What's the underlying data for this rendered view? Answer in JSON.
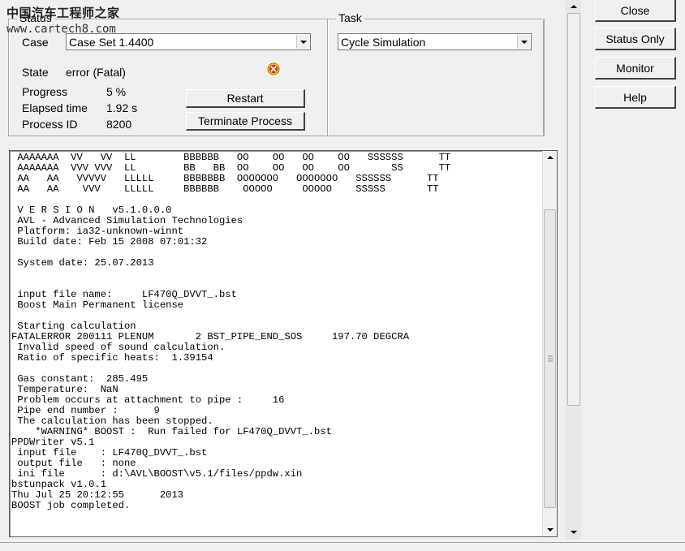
{
  "watermark": {
    "line1": "中国汽车工程师之家",
    "line2": "www.cartech8.com"
  },
  "status": {
    "group_title": "Status",
    "case_label": "Case",
    "case_value": "Case Set 1.4400",
    "state_label": "State",
    "state_value": "error (Fatal)",
    "progress_label": "Progress",
    "progress_value": "5 %",
    "elapsed_label": "Elapsed time",
    "elapsed_value": "1.92 s",
    "pid_label": "Process ID",
    "pid_value": "8200",
    "restart_label": "Restart",
    "terminate_label": "Terminate Process",
    "error_icon_color": "#e03010"
  },
  "task": {
    "group_title": "Task",
    "value": "Cycle Simulation"
  },
  "side_buttons": {
    "close": "Close",
    "status_only": "Status Only",
    "monitor": "Monitor",
    "help": "Help"
  },
  "console_text": " AAAAAAA  VV   VV  LL        BBBBBB   OO    OO   OO    OO   SSSSSS      TT\n AAAAAAA  VVV VVV  LL        BB   BB  OO    OO   OO    OO       SS      TT\n AA   AA   VVVVV   LLLLL     BBBBBBB  OOOOOOO   OOOOOOO   SSSSSS      TT\n AA   AA    VVV    LLLLL     BBBBBB    OOOOO     OOOOO    SSSSS       TT\n\n V E R S I O N   v5.1.0.0.0\n AVL - Advanced Simulation Technologies\n Platform: ia32-unknown-winnt\n Build date: Feb 15 2008 07:01:32\n\n System date: 25.07.2013\n\n\n input file name:     LF470Q_DVVT_.bst\n Boost Main Permanent license\n\n Starting calculation\nFATALERROR 200111 PLENUM       2 BST_PIPE_END_SOS     197.70 DEGCRA\n Invalid speed of sound calculation.\n Ratio of specific heats:  1.39154\n\n Gas constant:  285.495\n Temperature:  NaN\n Problem occurs at attachment to pipe :     16\n Pipe end number :      9\n The calculation has been stopped.\n    *WARNING* BOOST :  Run failed for LF470Q_DVVT_.bst\nPPDWriter v5.1\n input file    : LF470Q_DVVT_.bst\n output file   : none\n ini file      : d:\\AVL\\BOOST\\v5.1/files/ppdw.xin\nbstunpack v1.0.1\nThu Jul 25 20:12:55      2013\nBOOST job completed."
}
